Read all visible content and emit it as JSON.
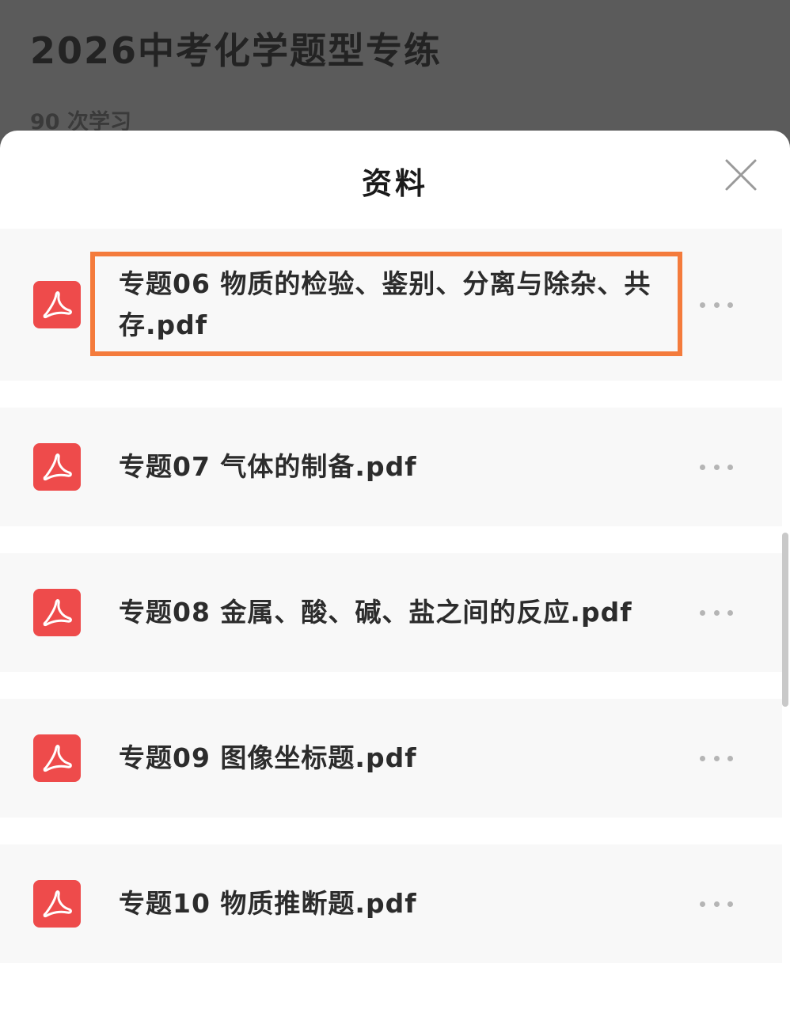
{
  "background": {
    "title": "2026中考化学题型专练",
    "study_count": "90 次学习"
  },
  "sheet": {
    "title": "资料",
    "close_icon": "close-icon"
  },
  "files": [
    {
      "name": "专题06 物质的检验、鉴别、分离与除杂、共存.pdf",
      "icon": "pdf-icon",
      "highlighted": true
    },
    {
      "name": "专题07 气体的制备.pdf",
      "icon": "pdf-icon",
      "highlighted": false
    },
    {
      "name": "专题08 金属、酸、碱、盐之间的反应.pdf",
      "icon": "pdf-icon",
      "highlighted": false
    },
    {
      "name": "专题09 图像坐标题.pdf",
      "icon": "pdf-icon",
      "highlighted": false
    },
    {
      "name": "专题10 物质推断题.pdf",
      "icon": "pdf-icon",
      "highlighted": false
    }
  ],
  "colors": {
    "pdf_red": "#ee4b4b",
    "highlight_orange": "#f47b3c",
    "overlay_gray": "#5b5b5b"
  }
}
